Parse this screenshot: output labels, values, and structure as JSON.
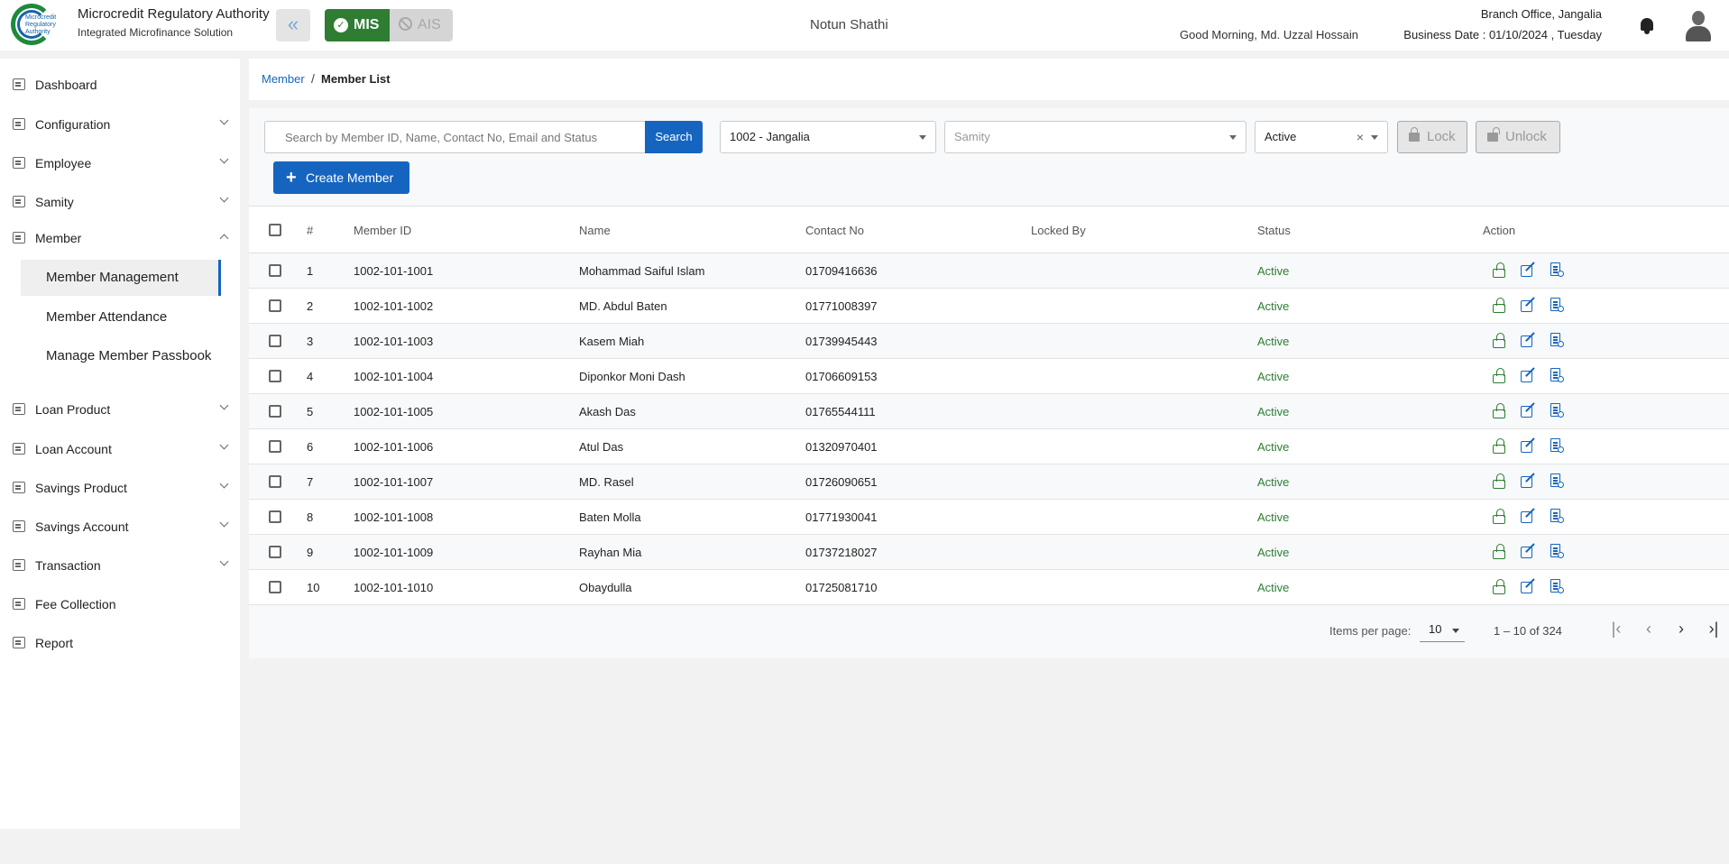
{
  "header": {
    "logo_lines": "Microcredit Regulatory Authority",
    "brand_title": "Microcredit Regulatory Authority",
    "brand_subtitle": "Integrated Microfinance Solution",
    "mis_label": "MIS",
    "ais_label": "AIS",
    "app_name": "Notun Shathi",
    "greeting": "Good Morning, Md. Uzzal Hossain",
    "branch": "Branch Office, Jangalia",
    "business_date": "Business Date : 01/10/2024 , Tuesday"
  },
  "sidebar": {
    "items": [
      {
        "label": "Dashboard"
      },
      {
        "label": "Configuration"
      },
      {
        "label": "Employee"
      },
      {
        "label": "Samity"
      },
      {
        "label": "Member"
      },
      {
        "label": "Loan Product"
      },
      {
        "label": "Loan Account"
      },
      {
        "label": "Savings Product"
      },
      {
        "label": "Savings Account"
      },
      {
        "label": "Transaction"
      },
      {
        "label": "Fee Collection"
      },
      {
        "label": "Report"
      }
    ],
    "member_sub": [
      {
        "label": "Member Management"
      },
      {
        "label": "Member Attendance"
      },
      {
        "label": "Manage Member Passbook"
      }
    ]
  },
  "breadcrumb": {
    "parent": "Member",
    "separator": "/",
    "current": "Member List"
  },
  "toolbar": {
    "search_placeholder": "Search by Member ID, Name, Contact No, Email and Status",
    "search_button": "Search",
    "branch_select": "1002 - Jangalia",
    "samity_placeholder": "Samity",
    "status_select": "Active",
    "clear_symbol": "×",
    "lock_button": "Lock",
    "unlock_button": "Unlock",
    "create_button": "Create Member",
    "create_plus": "+"
  },
  "table": {
    "headers": {
      "index": "#",
      "member_id": "Member ID",
      "name": "Name",
      "contact": "Contact No",
      "locked_by": "Locked By",
      "status": "Status",
      "action": "Action"
    },
    "rows": [
      {
        "n": "1",
        "id": "1002-101-1001",
        "name": "Mohammad Saiful Islam",
        "contact": "01709416636",
        "locked_by": "",
        "status": "Active"
      },
      {
        "n": "2",
        "id": "1002-101-1002",
        "name": "MD. Abdul Baten",
        "contact": "01771008397",
        "locked_by": "",
        "status": "Active"
      },
      {
        "n": "3",
        "id": "1002-101-1003",
        "name": "Kasem Miah",
        "contact": "01739945443",
        "locked_by": "",
        "status": "Active"
      },
      {
        "n": "4",
        "id": "1002-101-1004",
        "name": "Diponkor Moni Dash",
        "contact": "01706609153",
        "locked_by": "",
        "status": "Active"
      },
      {
        "n": "5",
        "id": "1002-101-1005",
        "name": "Akash Das",
        "contact": "01765544111",
        "locked_by": "",
        "status": "Active"
      },
      {
        "n": "6",
        "id": "1002-101-1006",
        "name": "Atul Das",
        "contact": "01320970401",
        "locked_by": "",
        "status": "Active"
      },
      {
        "n": "7",
        "id": "1002-101-1007",
        "name": "MD. Rasel",
        "contact": "01726090651",
        "locked_by": "",
        "status": "Active"
      },
      {
        "n": "8",
        "id": "1002-101-1008",
        "name": "Baten Molla",
        "contact": "01771930041",
        "locked_by": "",
        "status": "Active"
      },
      {
        "n": "9",
        "id": "1002-101-1009",
        "name": "Rayhan Mia",
        "contact": "01737218027",
        "locked_by": "",
        "status": "Active"
      },
      {
        "n": "10",
        "id": "1002-101-1010",
        "name": "Obaydulla",
        "contact": "01725081710",
        "locked_by": "",
        "status": "Active"
      }
    ]
  },
  "pagination": {
    "items_per_page_label": "Items per page:",
    "items_per_page": "10",
    "range": "1 – 10 of 324",
    "first_symbol": "|‹",
    "prev_symbol": "‹",
    "next_symbol": "›",
    "last_symbol": "›|"
  },
  "colors": {
    "primary": "#1565c0",
    "mis_green": "#2e7d32",
    "status_active": "#2e7d32"
  }
}
